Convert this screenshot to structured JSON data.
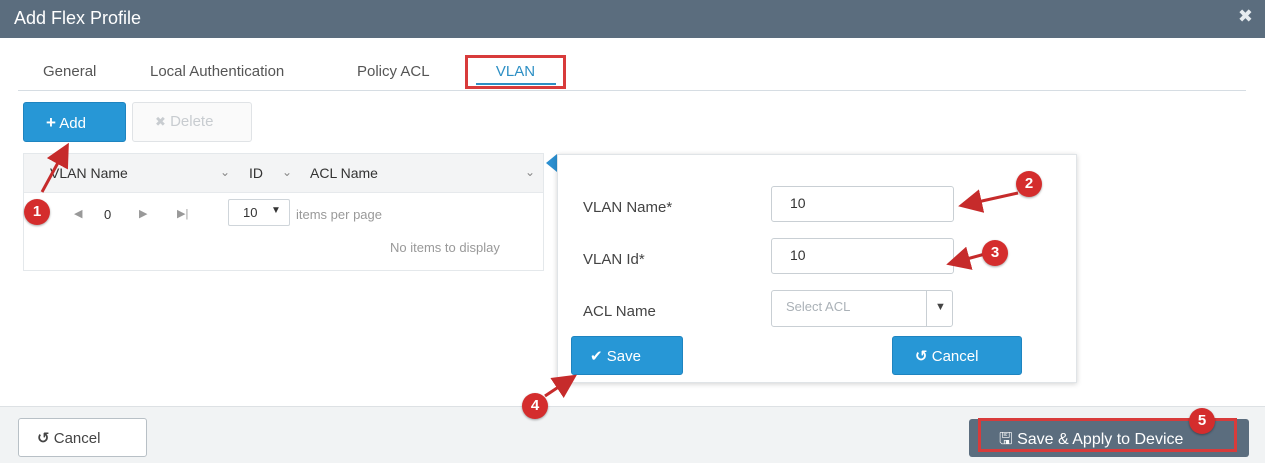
{
  "dialog": {
    "title": "Add Flex Profile",
    "close_icon": "close-icon"
  },
  "tabs": [
    {
      "label": "General"
    },
    {
      "label": "Local Authentication"
    },
    {
      "label": "Policy ACL"
    },
    {
      "label": "VLAN",
      "active": true
    }
  ],
  "toolbar": {
    "add_label": "Add",
    "delete_label": "Delete"
  },
  "grid": {
    "columns": [
      "VLAN Name",
      "ID",
      "ACL Name"
    ],
    "pager": {
      "page": "0",
      "page_size": "10",
      "items_per_page_label": "items per page",
      "empty_text": "No items to display"
    }
  },
  "form": {
    "vlan_name_label": "VLAN Name*",
    "vlan_name_value": "10",
    "vlan_id_label": "VLAN Id*",
    "vlan_id_value": "10",
    "acl_name_label": "ACL Name",
    "acl_placeholder": "Select ACL",
    "save_label": "Save",
    "cancel_label": "Cancel"
  },
  "footer": {
    "cancel_label": "Cancel",
    "apply_label": "Save & Apply to Device"
  },
  "annotations": {
    "steps": [
      "1",
      "2",
      "3",
      "4",
      "5"
    ],
    "color": "#d42d2d"
  },
  "colors": {
    "primary": "#2797d6",
    "header": "#5b6d7e",
    "highlight": "#d83b3b"
  }
}
